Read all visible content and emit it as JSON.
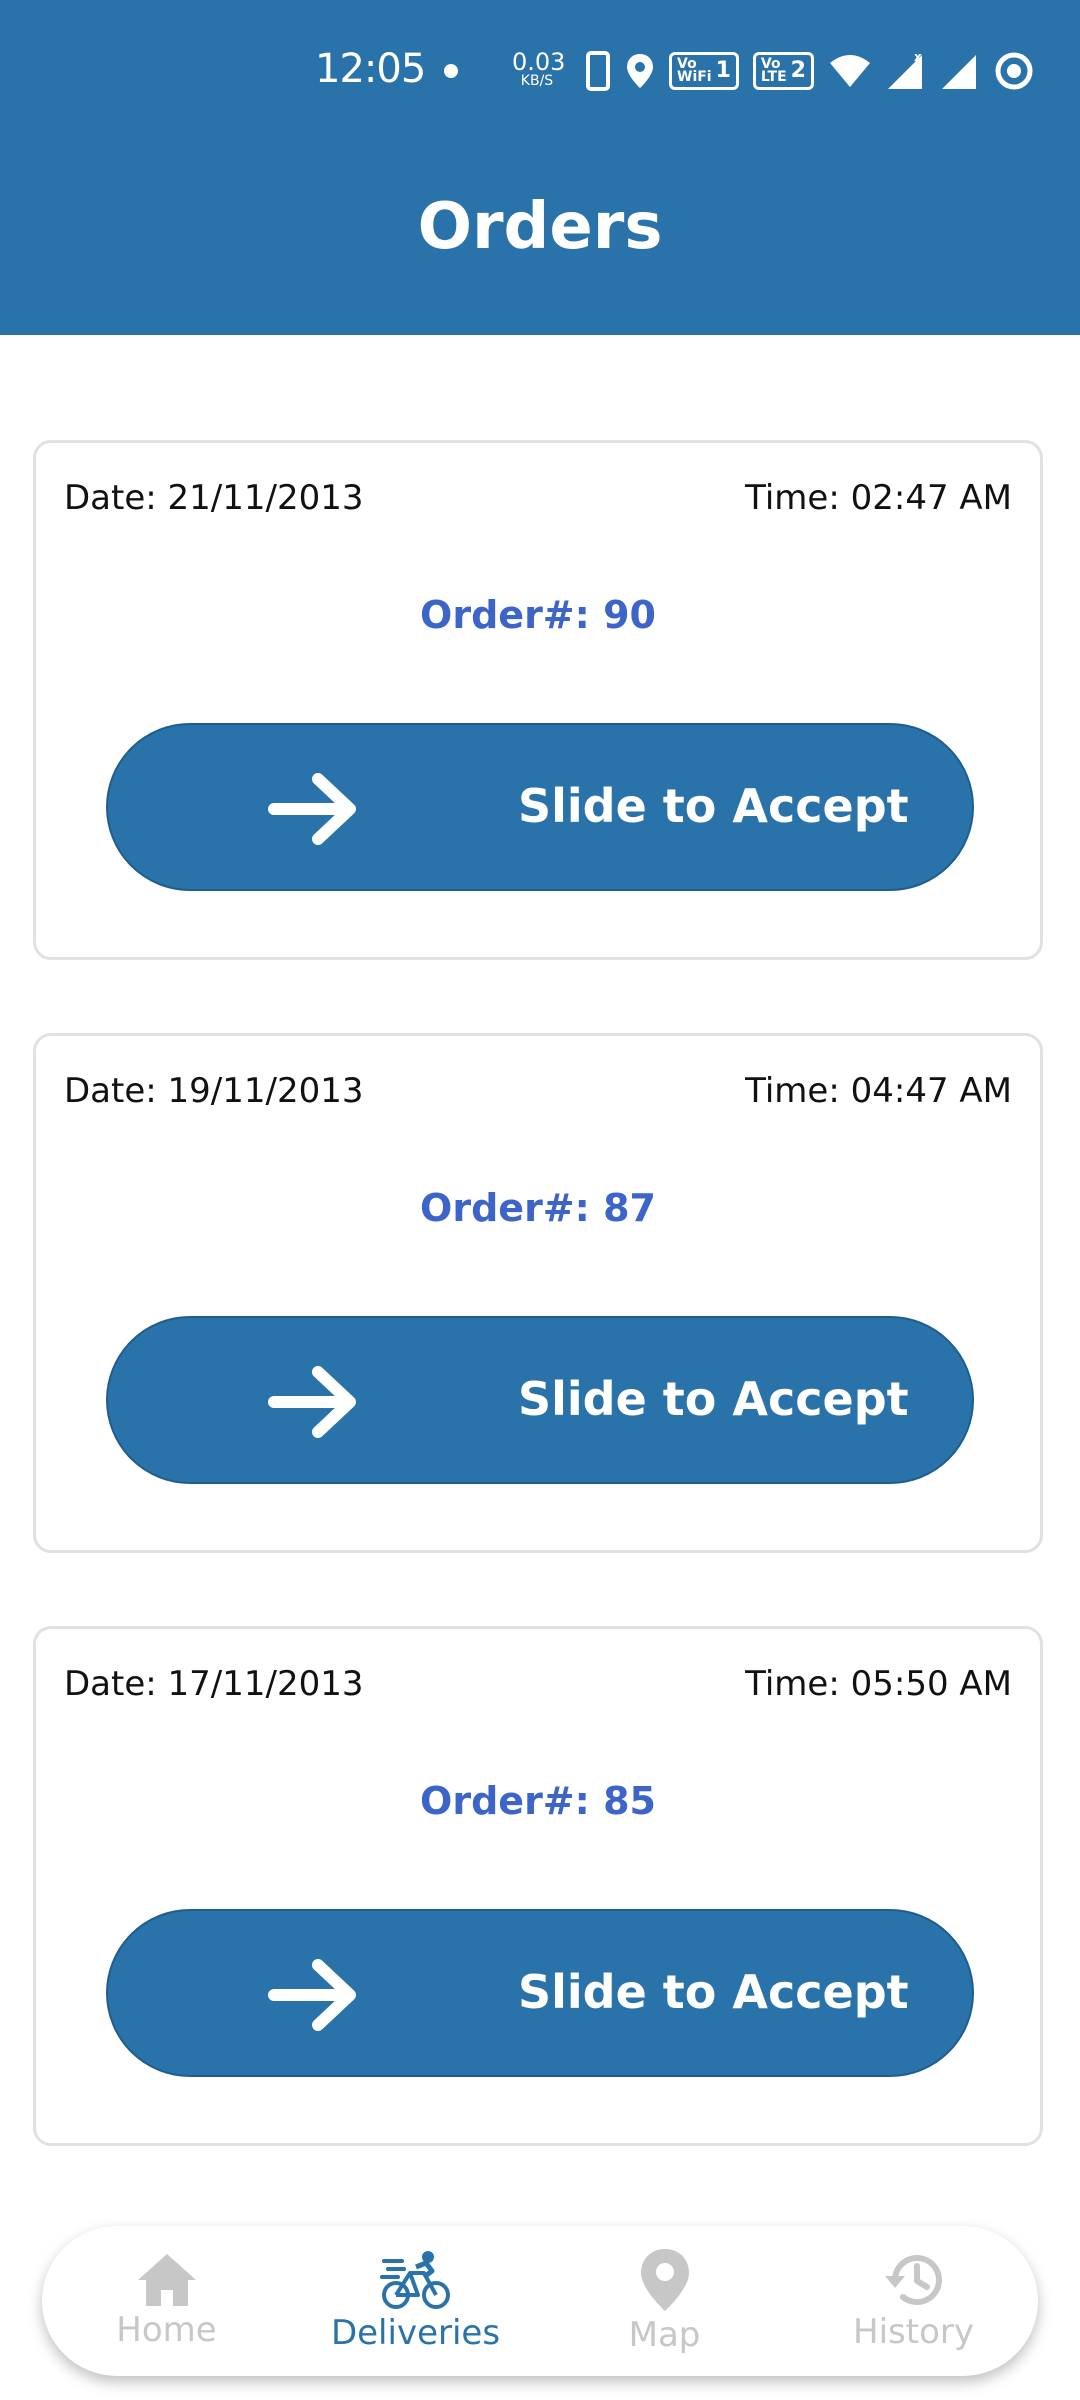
{
  "status_bar": {
    "time": "12:05",
    "net_speed_value": "0.03",
    "net_speed_unit": "KB/S",
    "sim1_label_top": "Vo",
    "sim1_label_bottom": "WiFi",
    "sim1_number": "1",
    "sim2_label_top": "Vo",
    "sim2_label_bottom": "LTE",
    "sim2_number": "2",
    "icons": [
      "vibrate-icon",
      "location-icon",
      "vowifi-icon",
      "volte-icon",
      "wifi-icon",
      "signal-icon",
      "signal-icon",
      "sync-icon"
    ]
  },
  "header": {
    "title": "Orders"
  },
  "orders": [
    {
      "date": "Date: 21/11/2013",
      "time": "Time: 02:47 AM",
      "order": "Order#: 90",
      "action": "Slide to Accept"
    },
    {
      "date": "Date: 19/11/2013",
      "time": "Time: 04:47 AM",
      "order": "Order#: 87",
      "action": "Slide to Accept"
    },
    {
      "date": "Date: 17/11/2013",
      "time": "Time: 05:50 AM",
      "order": "Order#: 85",
      "action": "Slide to Accept"
    }
  ],
  "bottom_nav": {
    "items": [
      {
        "label": "Home",
        "icon": "home-icon",
        "active": false
      },
      {
        "label": "Deliveries",
        "icon": "bicycle-icon",
        "active": true
      },
      {
        "label": "Map",
        "icon": "map-pin-icon",
        "active": false
      },
      {
        "label": "History",
        "icon": "history-icon",
        "active": false
      }
    ]
  },
  "colors": {
    "primary": "#2a72aa",
    "order_text": "#3d64c8",
    "inactive_nav": "#c7c7c7",
    "card_border": "#e1e1e1"
  }
}
